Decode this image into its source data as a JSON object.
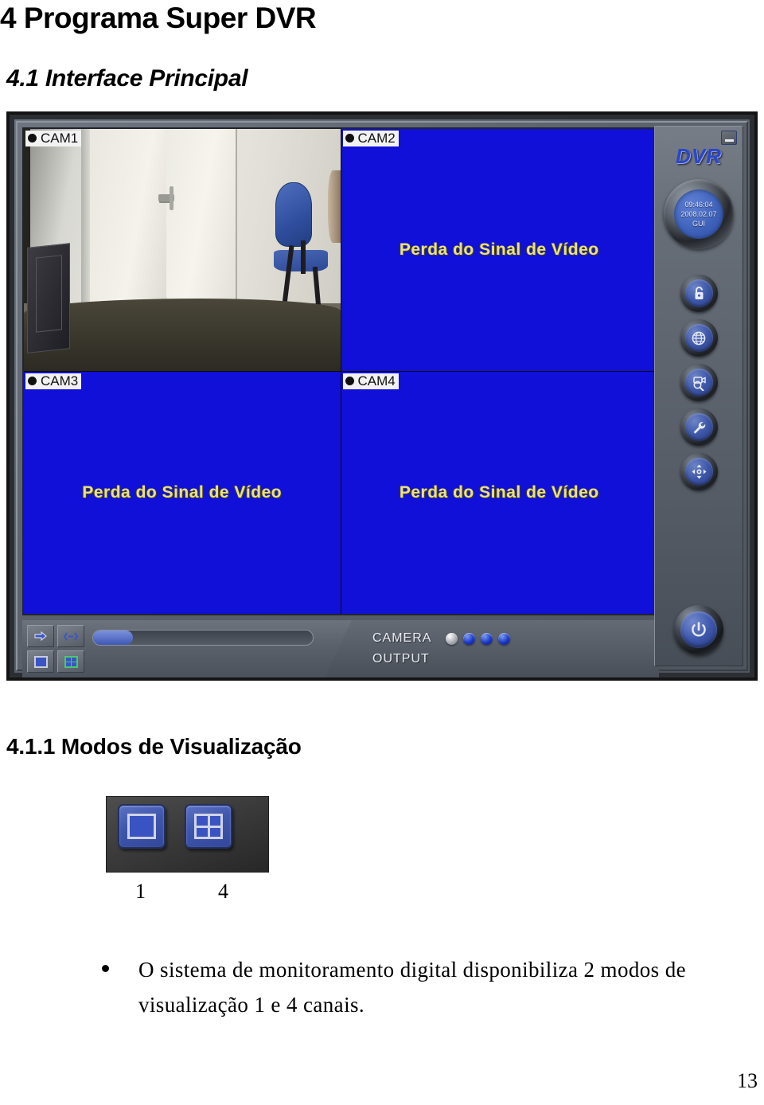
{
  "document": {
    "heading_1": "4 Programa Super DVR",
    "heading_2": "4.1 Interface Principal",
    "heading_3": "4.1.1 Modos de Visualização",
    "page_number": "13"
  },
  "dvr": {
    "logo": "DVR",
    "minimize_icon": "minimize-icon",
    "clock": {
      "time": "09:46:04",
      "date": "2008.02.07",
      "mode": "GUI"
    },
    "panes": [
      {
        "label": "CAM1",
        "status": "",
        "state": "live"
      },
      {
        "label": "CAM2",
        "status": "Perda do Sinal de Vídeo",
        "state": "no-signal"
      },
      {
        "label": "CAM3",
        "status": "Perda do Sinal de Vídeo",
        "state": "no-signal"
      },
      {
        "label": "CAM4",
        "status": "Perda do Sinal de Vídeo",
        "state": "no-signal"
      }
    ],
    "side_buttons": [
      {
        "name": "lock-icon",
        "title": "Bloquear"
      },
      {
        "name": "globe-icon",
        "title": "Rede"
      },
      {
        "name": "search-camera-icon",
        "title": "Reprodução"
      },
      {
        "name": "wrench-icon",
        "title": "Configuração"
      },
      {
        "name": "ptz-pad-icon",
        "title": "PTZ"
      }
    ],
    "power_button": {
      "name": "power-icon",
      "title": "Desligar"
    },
    "bottom_bar": {
      "next-channel-icon": "arrow-right-icon",
      "cycle-icon": "rotate-icon",
      "view1_icon": "single-view-icon",
      "view4_icon": "quad-view-icon",
      "progress_percent": 18,
      "camera_label": "CAMERA",
      "output_label": "OUTPUT",
      "camera_leds": [
        "off",
        "on",
        "on",
        "on"
      ]
    },
    "colors": {
      "no_signal_background": "#1010d8",
      "no_signal_text": "#e8e08a",
      "panel": "#5c636d",
      "button_blue": "#3d56a8"
    }
  },
  "view_modes": {
    "button_1": {
      "icon": "single-view-icon",
      "caption": "1"
    },
    "button_4": {
      "icon": "quad-view-icon",
      "caption": "4"
    }
  },
  "body": {
    "bullet_text": "O sistema de monitoramento digital disponibiliza 2 modos de visualização 1 e 4 canais."
  }
}
